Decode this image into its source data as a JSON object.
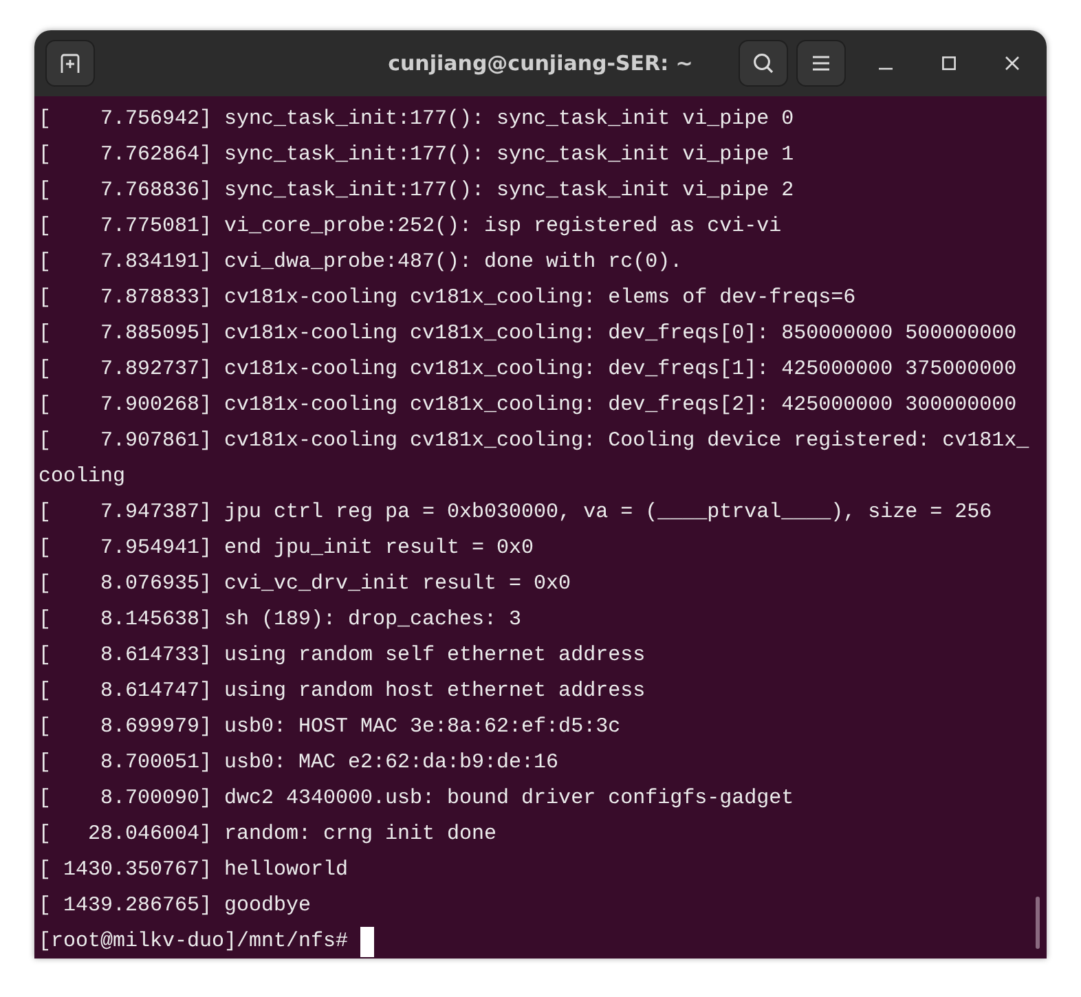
{
  "window": {
    "title": "cunjiang@cunjiang-SER: ~"
  },
  "terminal": {
    "lines": [
      "[    7.756942] sync_task_init:177(): sync_task_init vi_pipe 0",
      "[    7.762864] sync_task_init:177(): sync_task_init vi_pipe 1",
      "[    7.768836] sync_task_init:177(): sync_task_init vi_pipe 2",
      "[    7.775081] vi_core_probe:252(): isp registered as cvi-vi",
      "[    7.834191] cvi_dwa_probe:487(): done with rc(0).",
      "[    7.878833] cv181x-cooling cv181x_cooling: elems of dev-freqs=6",
      "[    7.885095] cv181x-cooling cv181x_cooling: dev_freqs[0]: 850000000 500000000",
      "[    7.892737] cv181x-cooling cv181x_cooling: dev_freqs[1]: 425000000 375000000",
      "[    7.900268] cv181x-cooling cv181x_cooling: dev_freqs[2]: 425000000 300000000",
      "[    7.907861] cv181x-cooling cv181x_cooling: Cooling device registered: cv181x_cooling",
      "[    7.947387] jpu ctrl reg pa = 0xb030000, va = (____ptrval____), size = 256",
      "[    7.954941] end jpu_init result = 0x0",
      "[    8.076935] cvi_vc_drv_init result = 0x0",
      "[    8.145638] sh (189): drop_caches: 3",
      "[    8.614733] using random self ethernet address",
      "[    8.614747] using random host ethernet address",
      "[    8.699979] usb0: HOST MAC 3e:8a:62:ef:d5:3c",
      "[    8.700051] usb0: MAC e2:62:da:b9:de:16",
      "[    8.700090] dwc2 4340000.usb: bound driver configfs-gadget",
      "[   28.046004] random: crng init done",
      "[ 1430.350767] helloworld",
      "[ 1439.286765] goodbye"
    ],
    "prompt": "[root@milkv-duo]/mnt/nfs#"
  }
}
